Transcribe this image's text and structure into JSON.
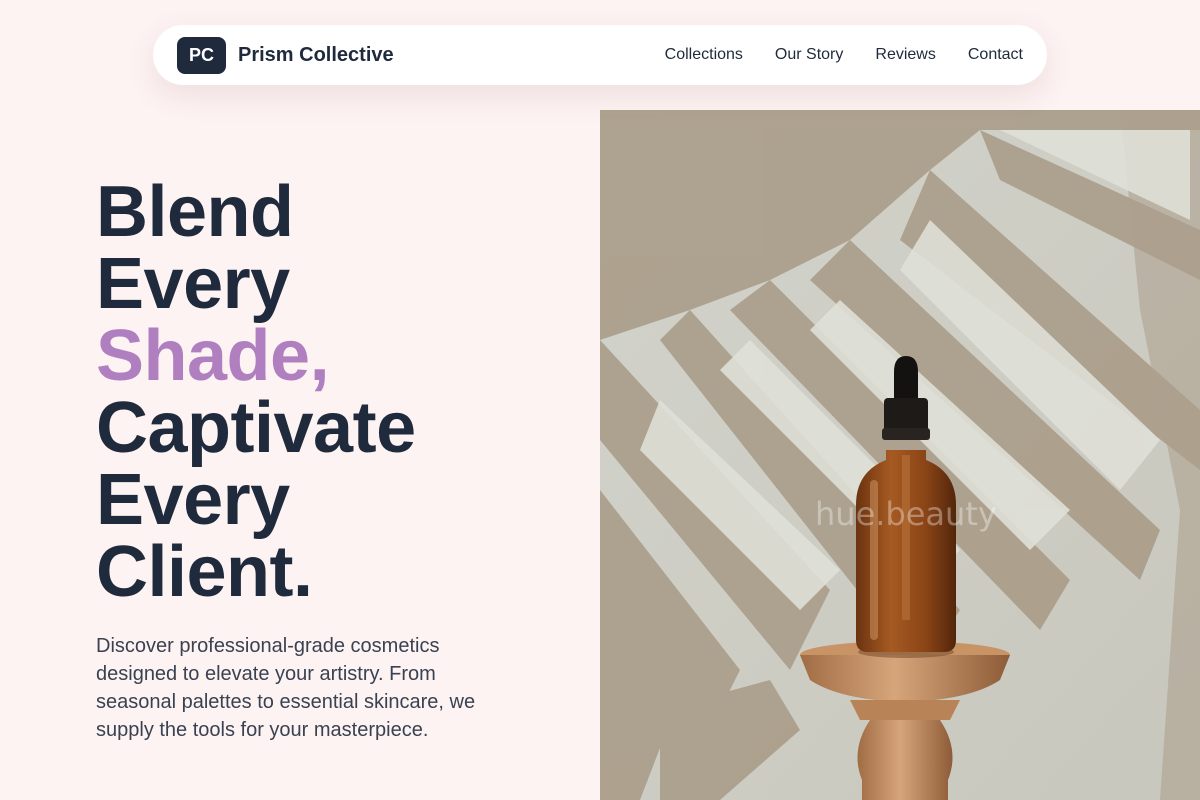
{
  "brand": {
    "badge": "PC",
    "name": "Prism Collective"
  },
  "nav": {
    "links": [
      "Collections",
      "Our Story",
      "Reviews",
      "Contact"
    ]
  },
  "hero": {
    "title_lines": [
      "Blend",
      "Every",
      "Shade,",
      "Captivate",
      "Every",
      "Client."
    ],
    "accent_line_index": 2,
    "description": "Discover professional-grade cosmetics designed to elevate your artistry. From seasonal palettes to essential skincare, we supply the tools for your masterpiece."
  },
  "photo": {
    "watermark": "hue.beauty"
  },
  "colors": {
    "background": "#fdf3f2",
    "text": "#1f2a3c",
    "accent": "#b07fc0"
  }
}
